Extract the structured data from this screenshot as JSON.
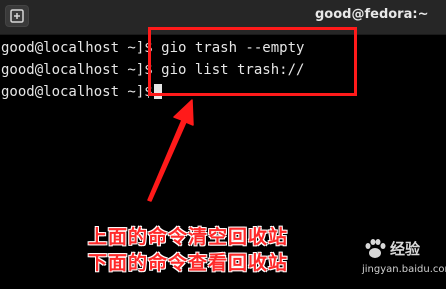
{
  "window": {
    "title": "good@fedora:~"
  },
  "terminal": {
    "lines": [
      "good@localhost ~]$ gio trash --empty",
      "good@localhost ~]$ gio list trash://",
      "good@localhost ~]$"
    ]
  },
  "annotation": {
    "line1": "上面的命令清空回收站",
    "line2": "下面的命令查看回收站"
  },
  "watermark": {
    "text": "经验",
    "url": "jingyan.baidu.com"
  },
  "colors": {
    "terminal_bg": "#000000",
    "terminal_fg": "#e6e6e6",
    "titlebar_bg": "#262626",
    "highlight": "#ff1a1a",
    "annotation": "#ff2a2a"
  }
}
